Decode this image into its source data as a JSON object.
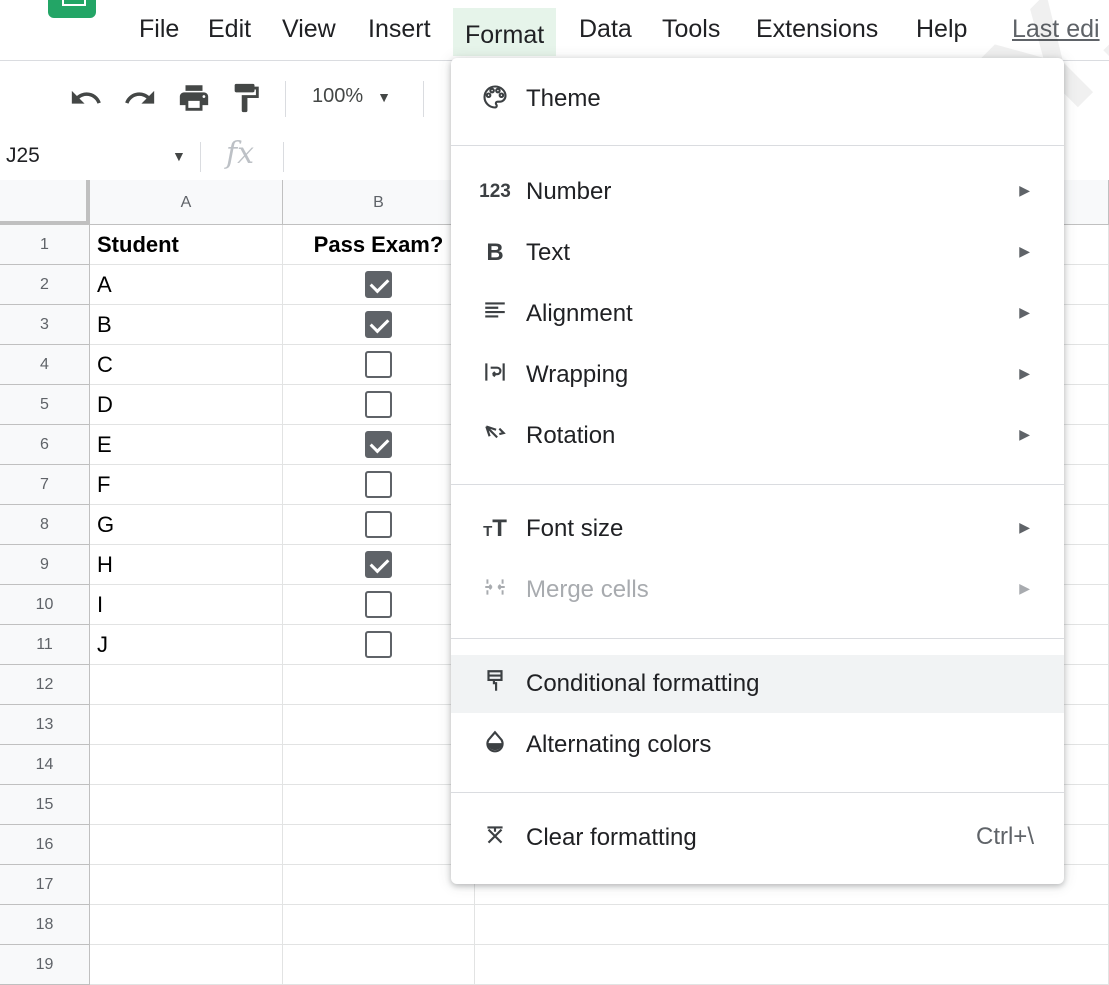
{
  "menubar": {
    "items": [
      "File",
      "Edit",
      "View",
      "Insert",
      "Format",
      "Data",
      "Tools",
      "Extensions",
      "Help"
    ],
    "active": "Format",
    "last_edit": "Last edi"
  },
  "toolbar": {
    "buttons": [
      "undo-icon",
      "redo-icon",
      "print-icon",
      "paint-format-icon"
    ],
    "zoom": "100%"
  },
  "formula_bar": {
    "name_box": "J25",
    "fx": "fx"
  },
  "sheet": {
    "columns": [
      "A",
      "B"
    ],
    "rows": [
      "1",
      "2",
      "3",
      "4",
      "5",
      "6",
      "7",
      "8",
      "9",
      "10",
      "11",
      "12",
      "13",
      "14",
      "15",
      "16",
      "17",
      "18",
      "19"
    ],
    "header": {
      "student": "Student",
      "pass": "Pass Exam?"
    },
    "students": [
      "A",
      "B",
      "C",
      "D",
      "E",
      "F",
      "G",
      "H",
      "I",
      "J"
    ],
    "passed": [
      true,
      true,
      false,
      false,
      true,
      false,
      false,
      true,
      false,
      false
    ]
  },
  "format_menu": {
    "theme": "Theme",
    "number": "Number",
    "text": "Text",
    "alignment": "Alignment",
    "wrapping": "Wrapping",
    "rotation": "Rotation",
    "font_size": "Font size",
    "merge_cells": "Merge cells",
    "conditional_formatting": "Conditional formatting",
    "alternating_colors": "Alternating colors",
    "clear_formatting": "Clear formatting",
    "clear_shortcut": "Ctrl+\\",
    "number_icon": "123",
    "text_icon": "B"
  },
  "watermark": "CHOLOGY.COM",
  "colors": {
    "active_menu_bg": "#e6f4ea",
    "hover_bg": "#f1f3f4",
    "sheets_green": "#23a566"
  }
}
